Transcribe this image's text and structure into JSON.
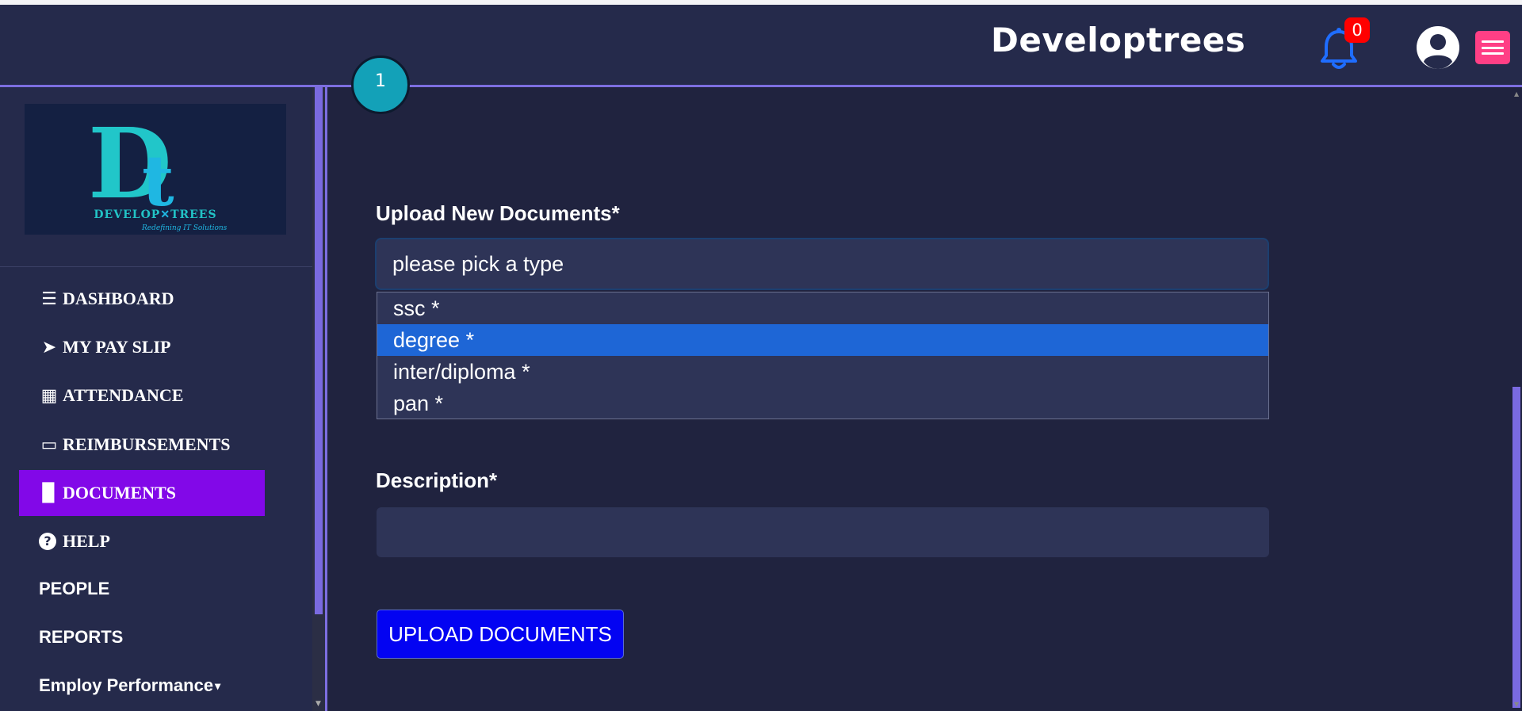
{
  "header": {
    "brand": "Developtrees",
    "notification_count": "0",
    "icons": [
      "bell-icon",
      "user-avatar-icon",
      "hamburger-menu-icon"
    ],
    "colors": {
      "badge": "#ff0000",
      "bell": "#1f6dff",
      "menu": "#ff3f85"
    }
  },
  "logo": {
    "letters": "D",
    "small_letter": "t",
    "wordmark_left": "DEVELOP",
    "wordmark_right": "TREES",
    "tagline": "Redefining IT Solutions"
  },
  "sidebar": {
    "items": [
      {
        "label": "DASHBOARD",
        "icon": "bars-icon",
        "glyph": "☰"
      },
      {
        "label": "MY PAY SLIP",
        "icon": "paper-plane-icon",
        "glyph": "➤"
      },
      {
        "label": "ATTENDANCE",
        "icon": "calendar-icon",
        "glyph": "▦"
      },
      {
        "label": "REIMBURSEMENTS",
        "icon": "credit-card-icon",
        "glyph": "▭"
      },
      {
        "label": "DOCUMENTS",
        "icon": "file-icon",
        "glyph": "▉",
        "active": true
      },
      {
        "label": "HELP",
        "icon": "question-circle-icon",
        "glyph": "?"
      },
      {
        "label": "PEOPLE"
      },
      {
        "label": "REPORTS"
      },
      {
        "label": "Employ Performance",
        "icon": "caret-down-icon",
        "glyph": "▾"
      }
    ],
    "active_color": "#8208e8"
  },
  "main": {
    "step_number": "1",
    "upload_label": "Upload New Documents*",
    "select_placeholder": "please pick a type",
    "options": [
      "ssc *",
      "degree *",
      "inter/diploma *",
      "pan *"
    ],
    "selected_option": "degree *",
    "description_label": "Description*",
    "description_value": "",
    "upload_button": "UPLOAD DOCUMENTS"
  }
}
